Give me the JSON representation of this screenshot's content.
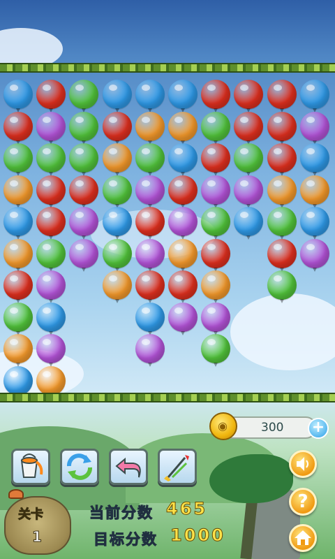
{
  "board": {
    "colors": {
      "blue": "#2f9ae8",
      "red": "#e0301f",
      "green": "#52c43b",
      "purple": "#b454d8",
      "orange": "#f59a2c"
    },
    "rows": [
      [
        "blue",
        "red",
        "green",
        "blue",
        "blue",
        "blue",
        "red",
        "red",
        "red",
        "blue"
      ],
      [
        "red",
        "purple",
        "green",
        "red",
        "orange",
        "orange",
        "green",
        "red",
        "red",
        "purple"
      ],
      [
        "green",
        "green",
        "green",
        "orange",
        "green",
        "blue",
        "red",
        "green",
        "red",
        "blue"
      ],
      [
        "orange",
        "red",
        "red",
        "green",
        "purple",
        "red",
        "purple",
        "purple",
        "orange",
        "orange"
      ],
      [
        "blue",
        "red",
        "purple",
        "blue",
        "red",
        "purple",
        "green",
        "blue",
        "green",
        "blue"
      ],
      [
        "orange",
        "green",
        "purple",
        "green",
        "purple",
        "orange",
        "red",
        null,
        "red",
        "purple"
      ],
      [
        "red",
        "purple",
        null,
        "orange",
        "red",
        "red",
        "orange",
        null,
        "green",
        null
      ],
      [
        "green",
        "blue",
        null,
        null,
        "blue",
        "purple",
        "purple",
        null,
        null,
        null
      ],
      [
        "orange",
        "purple",
        null,
        null,
        "purple",
        null,
        "green",
        null,
        null,
        null
      ],
      [
        "blue",
        "orange",
        null,
        null,
        null,
        null,
        null,
        null,
        null,
        null
      ]
    ]
  },
  "coins": {
    "value": "300",
    "plus_label": "+"
  },
  "tools": [
    {
      "name": "paint-bucket-tool",
      "icon": "paint-bucket-icon"
    },
    {
      "name": "refresh-tool",
      "icon": "refresh-icon"
    },
    {
      "name": "undo-tool",
      "icon": "undo-arrow-icon"
    },
    {
      "name": "dart-tool",
      "icon": "dart-icon"
    }
  ],
  "level": {
    "label": "关卡",
    "number": "1"
  },
  "score": {
    "current_label": "当前分数",
    "current_value": "465",
    "target_label": "目标分数",
    "target_value": "1000"
  },
  "side_buttons": [
    {
      "name": "sound-button",
      "icon": "speaker-icon"
    },
    {
      "name": "help-button",
      "icon": "question-icon",
      "glyph": "?"
    },
    {
      "name": "home-button",
      "icon": "home-icon"
    }
  ]
}
